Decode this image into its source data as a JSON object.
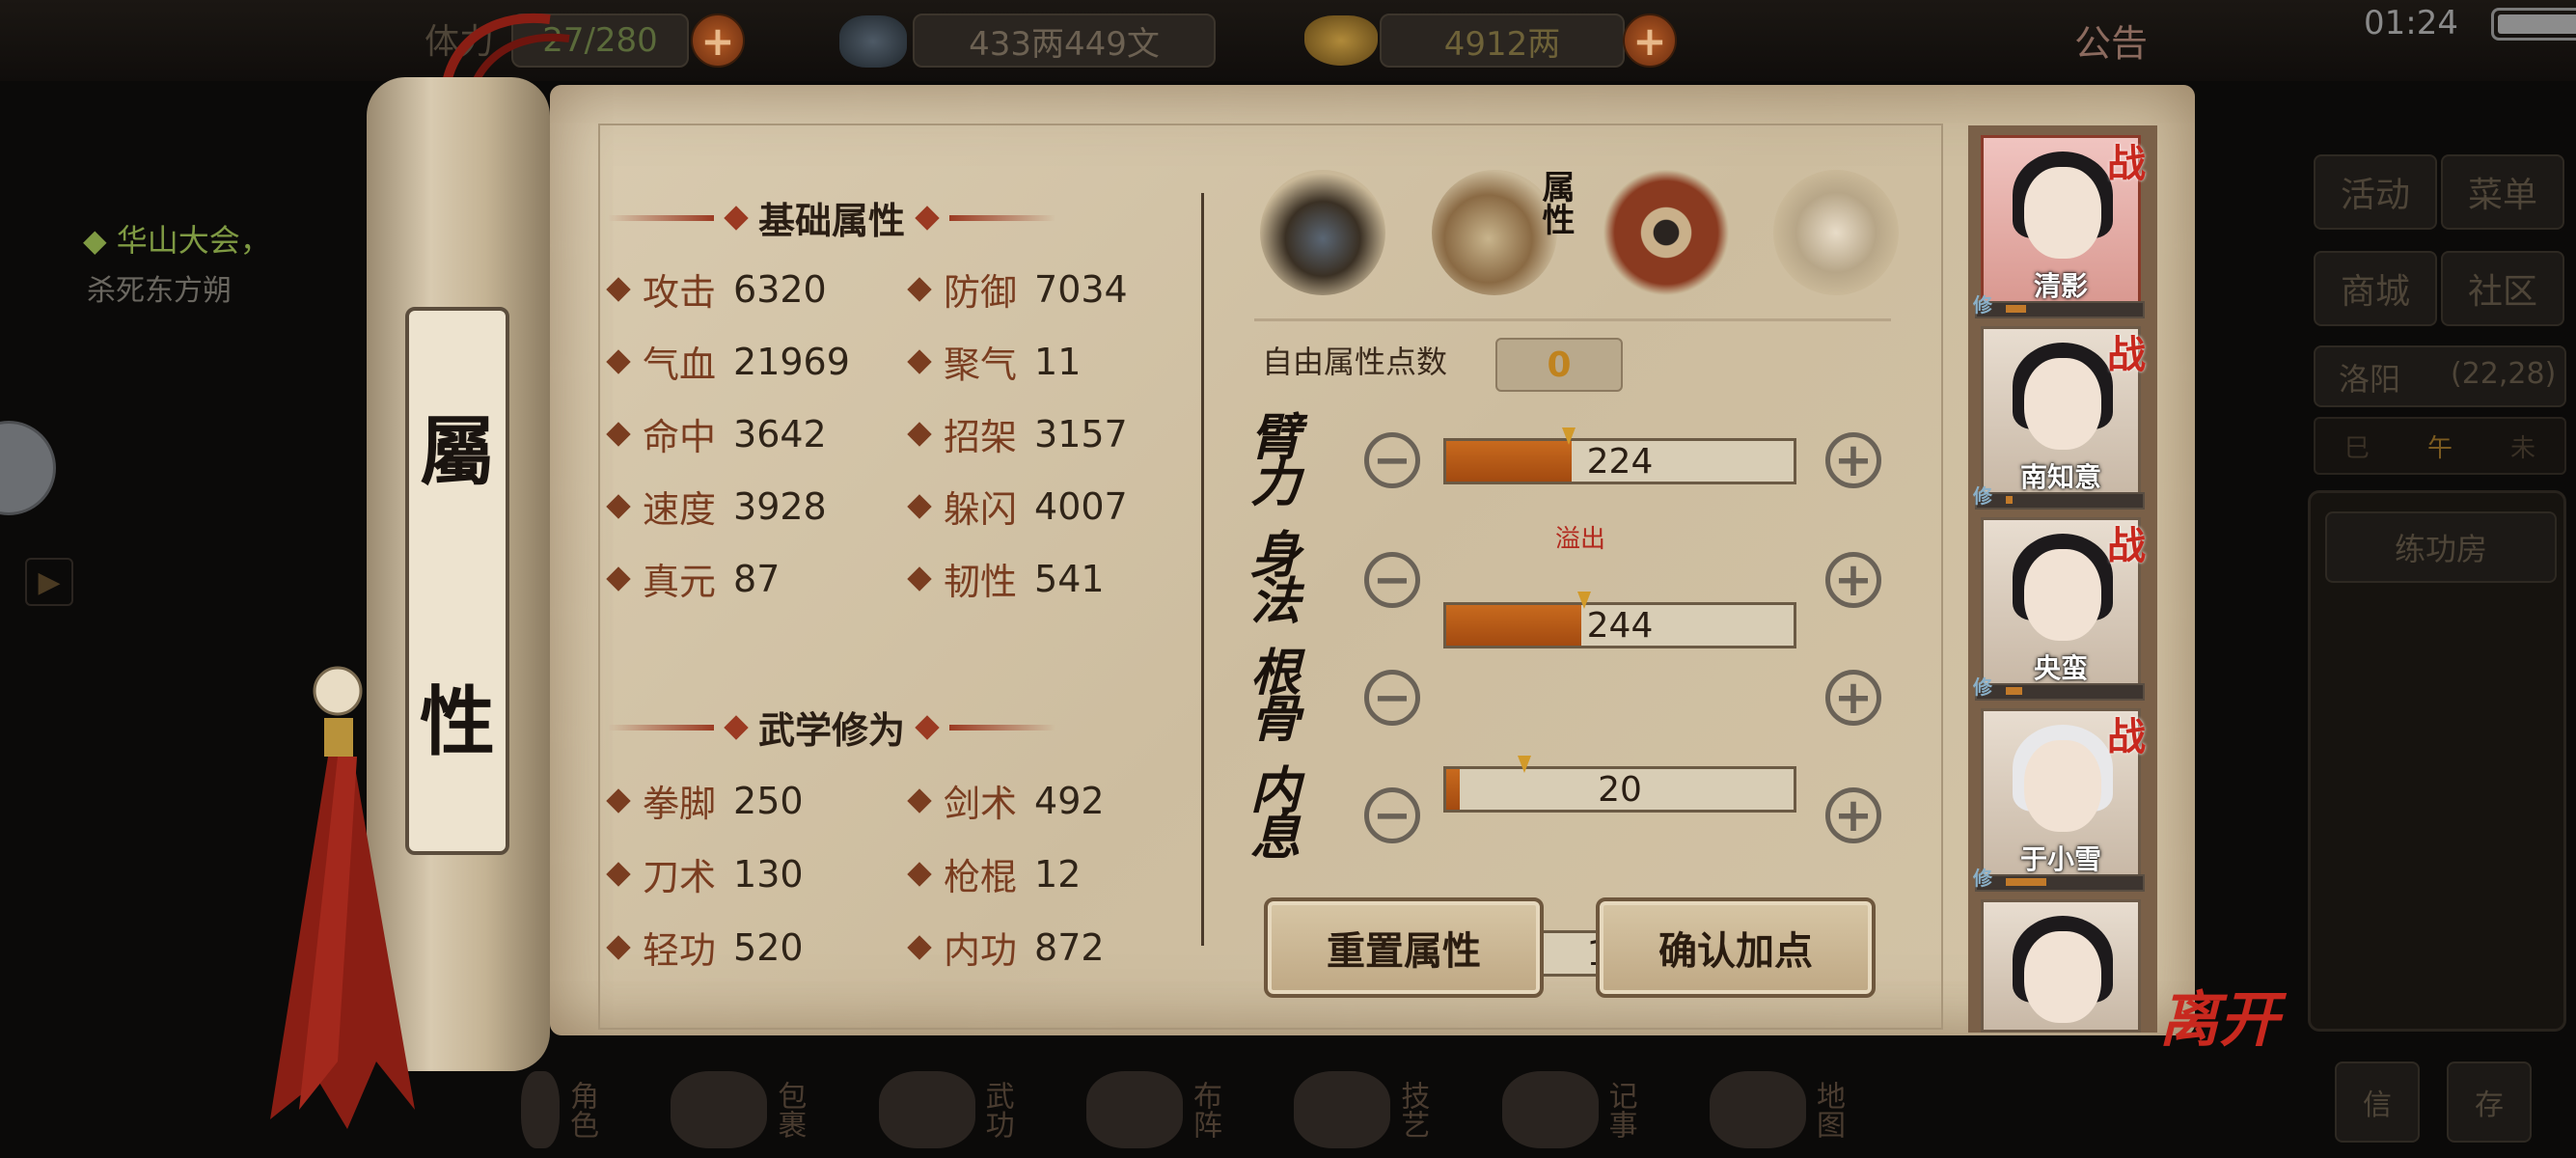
{
  "topbar": {
    "stamina_label": "体力",
    "stamina": "27/280",
    "money": "433两449文",
    "gold": "4912两",
    "notice": "公告",
    "time": "01:24"
  },
  "left_side": {
    "quest_title": "华山大会，",
    "quest_desc": "杀死东方朔"
  },
  "right_side": {
    "buttons": [
      "活动",
      "菜单",
      "商城",
      "社区"
    ],
    "location_name": "洛阳",
    "location_coords": "(22,28)",
    "compass": [
      "巳",
      "午",
      "未"
    ],
    "practice_room": "练功房",
    "bottom_buttons": [
      "信",
      "存"
    ]
  },
  "scroll": {
    "roller_chars": [
      "屬",
      "性"
    ]
  },
  "basic": {
    "title": "基础属性",
    "stats": [
      {
        "label": "攻击",
        "value": "6320"
      },
      {
        "label": "防御",
        "value": "7034"
      },
      {
        "label": "气血",
        "value": "21969"
      },
      {
        "label": "聚气",
        "value": "11"
      },
      {
        "label": "命中",
        "value": "3642"
      },
      {
        "label": "招架",
        "value": "3157"
      },
      {
        "label": "速度",
        "value": "3928"
      },
      {
        "label": "躲闪",
        "value": "4007"
      },
      {
        "label": "真元",
        "value": "87"
      },
      {
        "label": "韧性",
        "value": "541"
      }
    ]
  },
  "martial": {
    "title": "武学修为",
    "stats": [
      {
        "label": "拳脚",
        "value": "250"
      },
      {
        "label": "剑术",
        "value": "492"
      },
      {
        "label": "刀术",
        "value": "130"
      },
      {
        "label": "枪棍",
        "value": "12"
      },
      {
        "label": "轻功",
        "value": "520"
      },
      {
        "label": "内功",
        "value": "872"
      }
    ]
  },
  "tabs": {
    "attr_tab_label": "属性"
  },
  "allocation": {
    "free_points_label": "自由属性点数",
    "free_points": "0",
    "overflow_label": "溢出",
    "attributes": [
      {
        "name": "臂力",
        "value": "224",
        "fill": 0.36
      },
      {
        "name": "身法",
        "value": "244",
        "fill": 0.39
      },
      {
        "name": "根骨",
        "value": "20",
        "fill": 0.04
      },
      {
        "name": "内息",
        "value": "119",
        "fill": 0.22
      }
    ],
    "reset_label": "重置属性",
    "confirm_label": "确认加点"
  },
  "party": {
    "battle_mark": "战",
    "train_mark": "修",
    "members": [
      {
        "name": "清影",
        "train": 0.15
      },
      {
        "name": "南知意",
        "train": 0.05
      },
      {
        "name": "央蛮",
        "train": 0.12
      },
      {
        "name": "于小雪",
        "train": 0.3
      },
      {
        "name": ""
      }
    ]
  },
  "leave_label": "离开",
  "bottom_nav": [
    "角色",
    "包裹",
    "武功",
    "布阵",
    "技艺",
    "记事",
    "地图"
  ]
}
